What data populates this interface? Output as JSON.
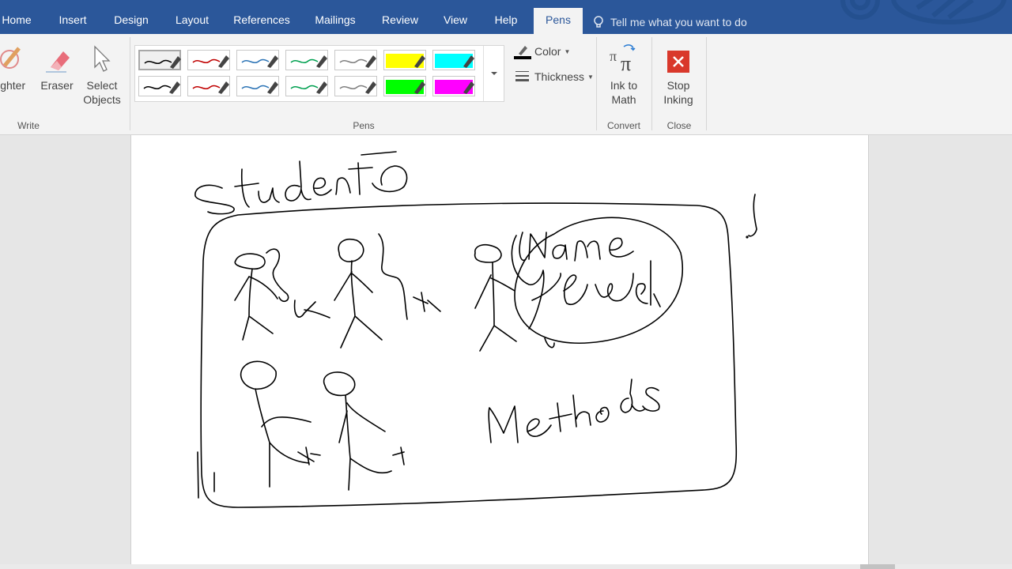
{
  "tabs": [
    {
      "label": "Home",
      "active": false
    },
    {
      "label": "Insert",
      "active": false
    },
    {
      "label": "Design",
      "active": false
    },
    {
      "label": "Layout",
      "active": false
    },
    {
      "label": "References",
      "active": false
    },
    {
      "label": "Mailings",
      "active": false
    },
    {
      "label": "Review",
      "active": false
    },
    {
      "label": "View",
      "active": false
    },
    {
      "label": "Help",
      "active": false
    },
    {
      "label": "Pens",
      "active": true
    }
  ],
  "tell_me": {
    "placeholder": "Tell me what you want to do",
    "icon": "lightbulb-icon"
  },
  "ribbon": {
    "write": {
      "group_label": "Write",
      "highlighter_label": "lighter",
      "eraser_label": "Eraser",
      "select_objects_label": [
        "Select",
        "Objects"
      ]
    },
    "pens": {
      "group_label": "Pens",
      "colors": [
        {
          "name": "black",
          "hex": "#000000",
          "kind": "pen"
        },
        {
          "name": "red",
          "hex": "#c00000",
          "kind": "pen"
        },
        {
          "name": "blue",
          "hex": "#2e75b6",
          "kind": "pen"
        },
        {
          "name": "green",
          "hex": "#00a050",
          "kind": "pen"
        },
        {
          "name": "gray",
          "hex": "#808080",
          "kind": "pen"
        },
        {
          "name": "yellow",
          "hex": "#ffff00",
          "kind": "highlighter"
        },
        {
          "name": "cyan",
          "hex": "#00ffff",
          "kind": "highlighter"
        },
        {
          "name": "black",
          "hex": "#000000",
          "kind": "pen"
        },
        {
          "name": "red",
          "hex": "#c00000",
          "kind": "pen"
        },
        {
          "name": "blue",
          "hex": "#2e75b6",
          "kind": "pen"
        },
        {
          "name": "green",
          "hex": "#00a050",
          "kind": "pen"
        },
        {
          "name": "gray",
          "hex": "#808080",
          "kind": "pen"
        },
        {
          "name": "green",
          "hex": "#00ff00",
          "kind": "highlighter"
        },
        {
          "name": "magenta",
          "hex": "#ff00ff",
          "kind": "highlighter"
        }
      ],
      "color_label": "Color",
      "thickness_label": "Thickness"
    },
    "convert": {
      "group_label": "Convert",
      "ink_to_math_label": [
        "Ink to",
        "Math"
      ]
    },
    "close": {
      "group_label": "Close",
      "stop_inking_label": [
        "Stop",
        "Inking"
      ]
    }
  },
  "colors": {
    "accent": "#2b579a",
    "stop": "#d9382b"
  }
}
